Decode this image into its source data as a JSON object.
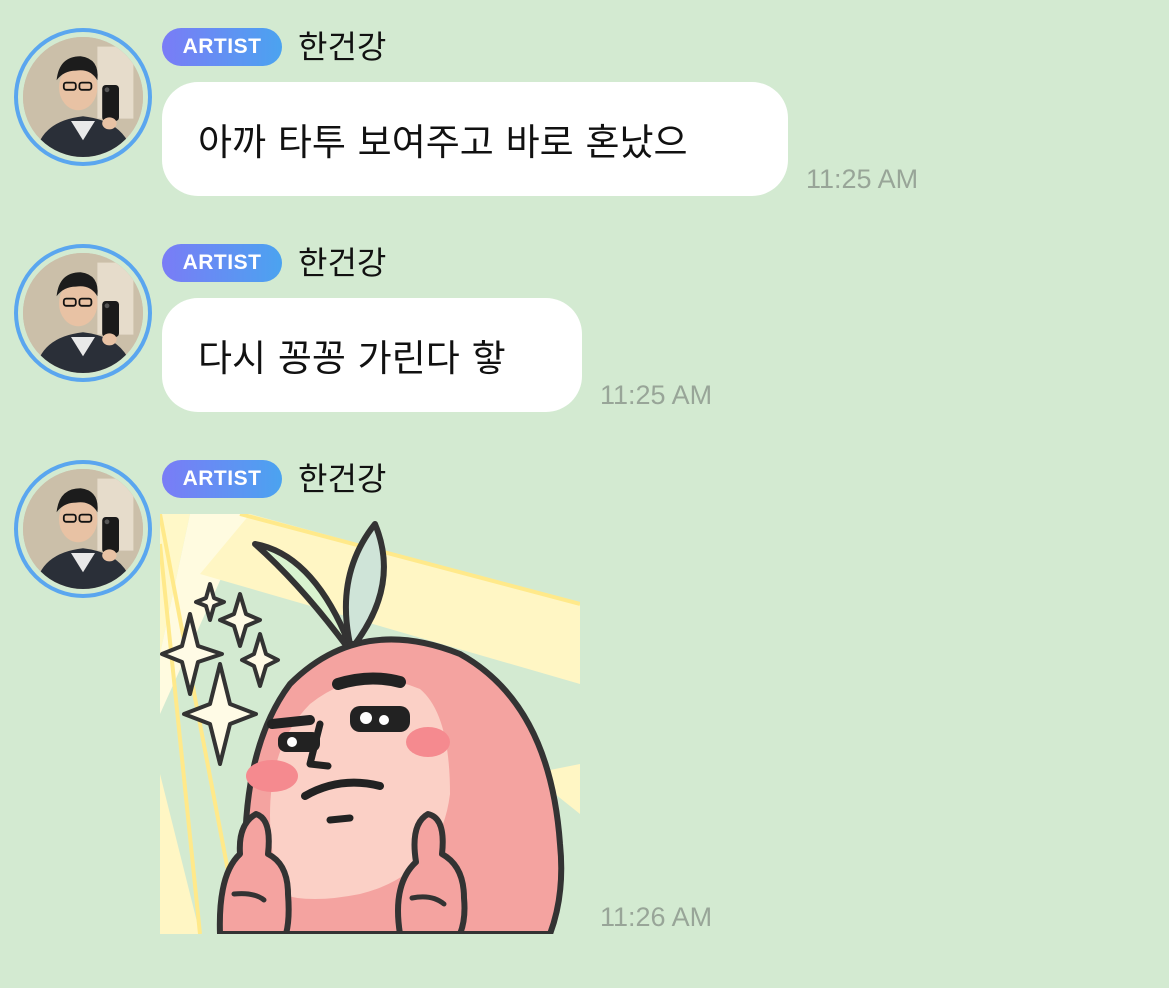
{
  "colors": {
    "background": "#d3ead1",
    "bubble": "#ffffff",
    "badge_gradient_start": "#7a7cf6",
    "badge_gradient_end": "#4ba3f0",
    "avatar_ring": "#5aa6ef",
    "timestamp": "#98a598"
  },
  "messages": [
    {
      "badge": "ARTIST",
      "sender": "한건강",
      "text": "아까 타투 보여주고 바로 혼났으",
      "time": "11:25 AM"
    },
    {
      "badge": "ARTIST",
      "sender": "한건강",
      "text": "다시 꽁꽁 가린다 핳",
      "time": "11:25 AM"
    },
    {
      "badge": "ARTIST",
      "sender": "한건강",
      "sticker_icon": "peach-character-thumbs-up-sticker",
      "time": "11:26 AM"
    }
  ]
}
